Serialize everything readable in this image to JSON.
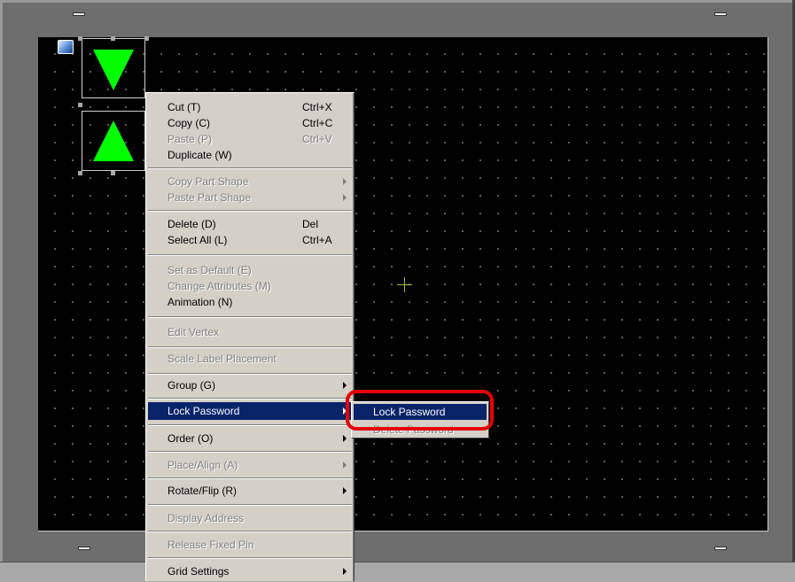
{
  "colors": {
    "menu_bg": "#d4d0c8",
    "highlight": "#0a246a",
    "shape_fill": "#00ff00",
    "callout": "#e60000",
    "canvas": "#000000"
  },
  "icons": {
    "corner": "globe-icon",
    "cursor": "crosshair-cursor-icon"
  },
  "context_menu": {
    "items": [
      {
        "label": "Cut (T)",
        "shortcut": "Ctrl+X"
      },
      {
        "label": "Copy (C)",
        "shortcut": "Ctrl+C"
      },
      {
        "label": "Paste (P)",
        "shortcut": "Ctrl+V"
      },
      {
        "label": "Duplicate (W)"
      },
      {
        "label": "Copy Part Shape"
      },
      {
        "label": "Paste Part Shape"
      },
      {
        "label": "Delete (D)",
        "shortcut": "Del"
      },
      {
        "label": "Select All (L)",
        "shortcut": "Ctrl+A"
      },
      {
        "label": "Set as Default (E)"
      },
      {
        "label": "Change Attributes (M)"
      },
      {
        "label": "Animation (N)"
      },
      {
        "label": "Edit Vertex"
      },
      {
        "label": "Scale Label Placement"
      },
      {
        "label": "Group (G)"
      },
      {
        "label": "Lock Password"
      },
      {
        "label": "Order (O)"
      },
      {
        "label": "Place/Align (A)"
      },
      {
        "label": "Rotate/Flip (R)"
      },
      {
        "label": "Display Address"
      },
      {
        "label": "Release Fixed Pin"
      },
      {
        "label": "Grid Settings"
      }
    ]
  },
  "submenu": {
    "items": [
      {
        "label": "Lock Password"
      },
      {
        "label": "Delete Password"
      }
    ]
  }
}
